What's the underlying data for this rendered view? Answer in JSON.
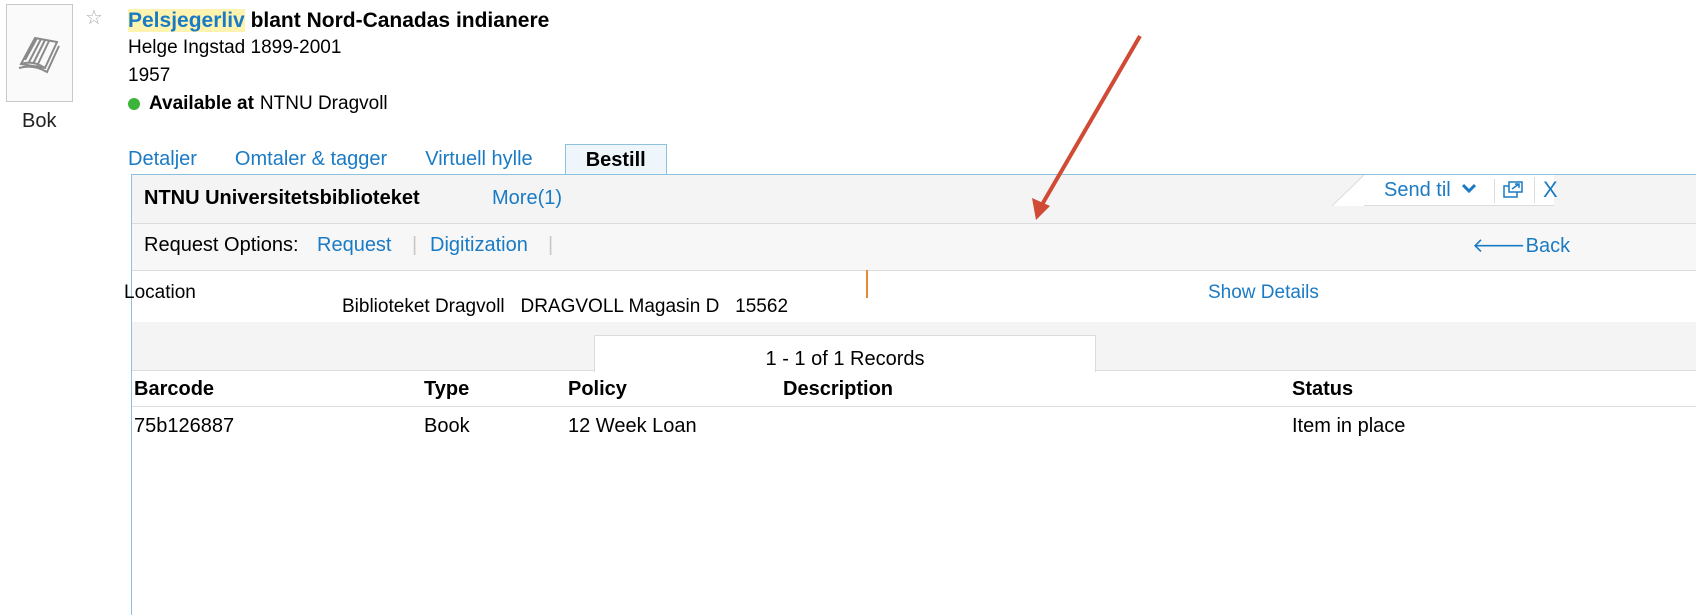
{
  "record": {
    "format_label": "Bok",
    "title_highlight": "Pelsjegerliv",
    "title_rest": " blant Nord-Canadas indianere",
    "author": "Helge Ingstad 1899-2001",
    "year": "1957",
    "availability_prefix": "Available at",
    "availability_location": "NTNU Dragvoll",
    "availability_color": "#3cb43c"
  },
  "tabs": [
    {
      "label": "Detaljer"
    },
    {
      "label": "Omtaler & tagger"
    },
    {
      "label": "Virtuell hylle"
    },
    {
      "label": "Bestill",
      "active": true
    }
  ],
  "panel": {
    "library_name": "NTNU Universitetsbiblioteket",
    "more_label": "More(1)",
    "send_to_label": "Send til",
    "close_label": "X"
  },
  "request": {
    "label": "Request Options:",
    "options": [
      "Request",
      "Digitization"
    ],
    "back_label": "Back"
  },
  "location": {
    "label": "Location",
    "value": "Biblioteket Dragvoll   DRAGVOLL Magasin D   15562",
    "show_details_label": "Show Details"
  },
  "records": {
    "summary": "1 - 1 of 1 Records",
    "columns": [
      "Barcode",
      "Type",
      "Policy",
      "Description",
      "Status"
    ],
    "rows": [
      {
        "barcode": "75b126887",
        "type": "Book",
        "policy": "12 Week Loan",
        "description": "",
        "status": "Item in place"
      }
    ]
  },
  "colors": {
    "link": "#1a7bc4",
    "panel_border": "#8ec1de",
    "annotation_arrow": "#d04a35"
  },
  "icons": {
    "thumbnail": "open-book-icon",
    "favorite": "star-outline-icon",
    "send_to_caret": "chevron-down-icon",
    "popout": "popout-window-icon",
    "back": "arrow-left-icon"
  }
}
